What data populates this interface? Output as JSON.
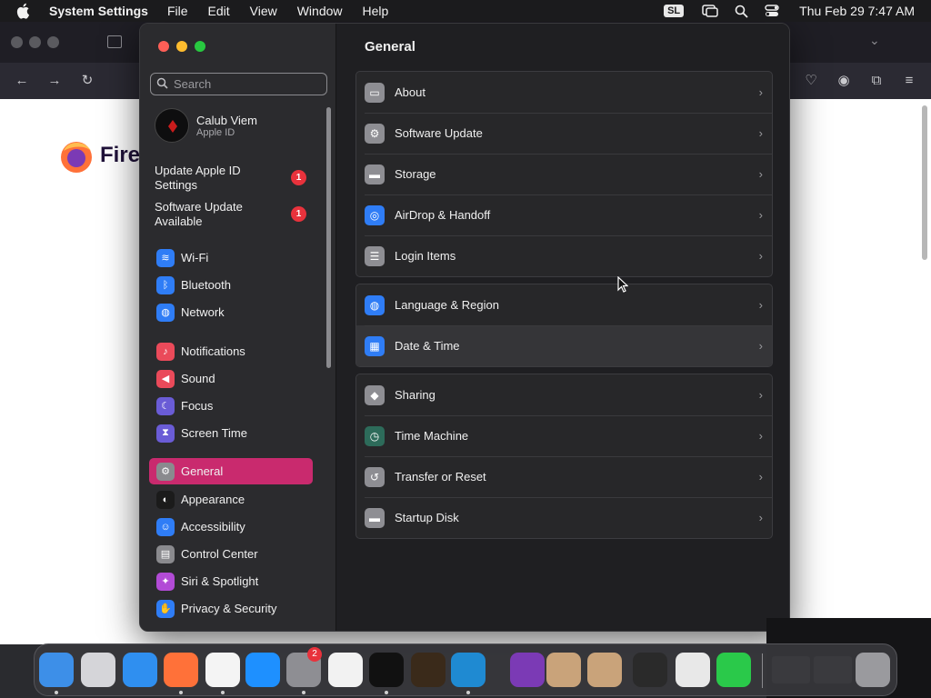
{
  "menubar": {
    "app_name": "System Settings",
    "menus": [
      "File",
      "Edit",
      "View",
      "Window",
      "Help"
    ],
    "sl_badge": "SL",
    "clock": "Thu Feb 29  7:47 AM"
  },
  "background_window": {
    "logo_text": "Firef"
  },
  "sidebar": {
    "search_placeholder": "Search",
    "account": {
      "name": "Calub Viem",
      "subtitle": "Apple ID"
    },
    "notices": [
      {
        "label": "Update Apple ID Settings",
        "badge": "1"
      },
      {
        "label": "Software Update Available",
        "badge": "1"
      }
    ],
    "items": [
      {
        "label": "Wi-Fi",
        "icon": "wifi-icon",
        "color": "#2f7df6"
      },
      {
        "label": "Bluetooth",
        "icon": "bluetooth-icon",
        "color": "#2f7df6"
      },
      {
        "label": "Network",
        "icon": "globe-icon",
        "color": "#2f7df6"
      },
      {
        "label": "Notifications",
        "icon": "bell-icon",
        "color": "#ea4a5a"
      },
      {
        "label": "Sound",
        "icon": "speaker-icon",
        "color": "#ea4a5a"
      },
      {
        "label": "Focus",
        "icon": "moon-icon",
        "color": "#6a5cd6"
      },
      {
        "label": "Screen Time",
        "icon": "hourglass-icon",
        "color": "#6a5cd6"
      },
      {
        "label": "General",
        "icon": "gear-icon",
        "color": "#8a8a8e",
        "active": true
      },
      {
        "label": "Appearance",
        "icon": "appearance-icon",
        "color": "#1b1b1b"
      },
      {
        "label": "Accessibility",
        "icon": "accessibility-icon",
        "color": "#2f7df6"
      },
      {
        "label": "Control Center",
        "icon": "control-center-icon",
        "color": "#8a8a8e"
      },
      {
        "label": "Siri & Spotlight",
        "icon": "siri-icon",
        "color": "#b24bd6"
      },
      {
        "label": "Privacy & Security",
        "icon": "hand-icon",
        "color": "#2f7df6"
      }
    ]
  },
  "main": {
    "title": "General",
    "groups": [
      [
        {
          "label": "About",
          "icon": "display-icon",
          "color": "#8e8e93"
        },
        {
          "label": "Software Update",
          "icon": "gear-update-icon",
          "color": "#8e8e93"
        },
        {
          "label": "Storage",
          "icon": "storage-icon",
          "color": "#8e8e93"
        },
        {
          "label": "AirDrop & Handoff",
          "icon": "airdrop-icon",
          "color": "#2f7df6"
        },
        {
          "label": "Login Items",
          "icon": "list-icon",
          "color": "#8e8e93"
        }
      ],
      [
        {
          "label": "Language & Region",
          "icon": "globe-icon",
          "color": "#2f7df6"
        },
        {
          "label": "Date & Time",
          "icon": "calendar-icon",
          "color": "#2f7df6",
          "highlight": true
        }
      ],
      [
        {
          "label": "Sharing",
          "icon": "sharing-icon",
          "color": "#8e8e93"
        },
        {
          "label": "Time Machine",
          "icon": "time-machine-icon",
          "color": "#2d6b5a"
        },
        {
          "label": "Transfer or Reset",
          "icon": "reset-icon",
          "color": "#8e8e93"
        },
        {
          "label": "Startup Disk",
          "icon": "disk-icon",
          "color": "#8e8e93"
        }
      ]
    ]
  },
  "dock": {
    "badge": "2",
    "apps": [
      {
        "name": "finder-icon",
        "color": "#3d8fe8"
      },
      {
        "name": "launchpad-icon",
        "color": "#d5d5d9"
      },
      {
        "name": "safari-icon",
        "color": "#2f8ff0"
      },
      {
        "name": "firefox-icon",
        "color": "#ff7139"
      },
      {
        "name": "chrome-icon",
        "color": "#f4f4f4"
      },
      {
        "name": "app-store-icon",
        "color": "#1e90ff"
      },
      {
        "name": "system-settings-icon",
        "color": "#8e8e93"
      },
      {
        "name": "textedit-icon",
        "color": "#f2f2f2"
      },
      {
        "name": "terminal-icon",
        "color": "#111111"
      },
      {
        "name": "garageband-icon",
        "color": "#3a2a1a"
      },
      {
        "name": "vscode-icon",
        "color": "#1f8ad2"
      },
      {
        "name": "affinity-icon",
        "color": "#7b3ab5"
      },
      {
        "name": "package-icon",
        "color": "#c9a37a"
      },
      {
        "name": "package-icon-2",
        "color": "#c9a37a"
      },
      {
        "name": "console-icon",
        "color": "#2a2a2a"
      },
      {
        "name": "disk-utility-icon",
        "color": "#e8e8e8"
      },
      {
        "name": "activity-monitor-icon",
        "color": "#2ac94a"
      },
      {
        "name": "window-thumbnail-icon",
        "color": "#3a3a3e"
      },
      {
        "name": "window-thumbnail-icon-2",
        "color": "#3a3a3e"
      },
      {
        "name": "trash-icon",
        "color": "#9a9a9e"
      }
    ]
  }
}
